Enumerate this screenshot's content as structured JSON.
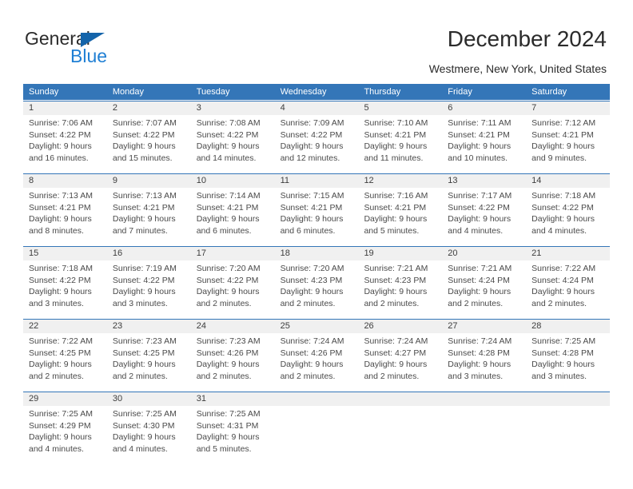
{
  "brand": {
    "word1": "General",
    "word2": "Blue",
    "triangle_color": "#1464aa",
    "blue_color": "#1f7fd4"
  },
  "header": {
    "title": "December 2024",
    "location": "Westmere, New York, United States"
  },
  "calendar": {
    "accent_color": "#3476b8",
    "day_header_bg": "#f0f0f0",
    "weekday_headers": [
      "Sunday",
      "Monday",
      "Tuesday",
      "Wednesday",
      "Thursday",
      "Friday",
      "Saturday"
    ],
    "weeks": [
      [
        {
          "day": "1",
          "sunrise": "Sunrise: 7:06 AM",
          "sunset": "Sunset: 4:22 PM",
          "daylight_line1": "Daylight: 9 hours",
          "daylight_line2": "and 16 minutes."
        },
        {
          "day": "2",
          "sunrise": "Sunrise: 7:07 AM",
          "sunset": "Sunset: 4:22 PM",
          "daylight_line1": "Daylight: 9 hours",
          "daylight_line2": "and 15 minutes."
        },
        {
          "day": "3",
          "sunrise": "Sunrise: 7:08 AM",
          "sunset": "Sunset: 4:22 PM",
          "daylight_line1": "Daylight: 9 hours",
          "daylight_line2": "and 14 minutes."
        },
        {
          "day": "4",
          "sunrise": "Sunrise: 7:09 AM",
          "sunset": "Sunset: 4:22 PM",
          "daylight_line1": "Daylight: 9 hours",
          "daylight_line2": "and 12 minutes."
        },
        {
          "day": "5",
          "sunrise": "Sunrise: 7:10 AM",
          "sunset": "Sunset: 4:21 PM",
          "daylight_line1": "Daylight: 9 hours",
          "daylight_line2": "and 11 minutes."
        },
        {
          "day": "6",
          "sunrise": "Sunrise: 7:11 AM",
          "sunset": "Sunset: 4:21 PM",
          "daylight_line1": "Daylight: 9 hours",
          "daylight_line2": "and 10 minutes."
        },
        {
          "day": "7",
          "sunrise": "Sunrise: 7:12 AM",
          "sunset": "Sunset: 4:21 PM",
          "daylight_line1": "Daylight: 9 hours",
          "daylight_line2": "and 9 minutes."
        }
      ],
      [
        {
          "day": "8",
          "sunrise": "Sunrise: 7:13 AM",
          "sunset": "Sunset: 4:21 PM",
          "daylight_line1": "Daylight: 9 hours",
          "daylight_line2": "and 8 minutes."
        },
        {
          "day": "9",
          "sunrise": "Sunrise: 7:13 AM",
          "sunset": "Sunset: 4:21 PM",
          "daylight_line1": "Daylight: 9 hours",
          "daylight_line2": "and 7 minutes."
        },
        {
          "day": "10",
          "sunrise": "Sunrise: 7:14 AM",
          "sunset": "Sunset: 4:21 PM",
          "daylight_line1": "Daylight: 9 hours",
          "daylight_line2": "and 6 minutes."
        },
        {
          "day": "11",
          "sunrise": "Sunrise: 7:15 AM",
          "sunset": "Sunset: 4:21 PM",
          "daylight_line1": "Daylight: 9 hours",
          "daylight_line2": "and 6 minutes."
        },
        {
          "day": "12",
          "sunrise": "Sunrise: 7:16 AM",
          "sunset": "Sunset: 4:21 PM",
          "daylight_line1": "Daylight: 9 hours",
          "daylight_line2": "and 5 minutes."
        },
        {
          "day": "13",
          "sunrise": "Sunrise: 7:17 AM",
          "sunset": "Sunset: 4:22 PM",
          "daylight_line1": "Daylight: 9 hours",
          "daylight_line2": "and 4 minutes."
        },
        {
          "day": "14",
          "sunrise": "Sunrise: 7:18 AM",
          "sunset": "Sunset: 4:22 PM",
          "daylight_line1": "Daylight: 9 hours",
          "daylight_line2": "and 4 minutes."
        }
      ],
      [
        {
          "day": "15",
          "sunrise": "Sunrise: 7:18 AM",
          "sunset": "Sunset: 4:22 PM",
          "daylight_line1": "Daylight: 9 hours",
          "daylight_line2": "and 3 minutes."
        },
        {
          "day": "16",
          "sunrise": "Sunrise: 7:19 AM",
          "sunset": "Sunset: 4:22 PM",
          "daylight_line1": "Daylight: 9 hours",
          "daylight_line2": "and 3 minutes."
        },
        {
          "day": "17",
          "sunrise": "Sunrise: 7:20 AM",
          "sunset": "Sunset: 4:22 PM",
          "daylight_line1": "Daylight: 9 hours",
          "daylight_line2": "and 2 minutes."
        },
        {
          "day": "18",
          "sunrise": "Sunrise: 7:20 AM",
          "sunset": "Sunset: 4:23 PM",
          "daylight_line1": "Daylight: 9 hours",
          "daylight_line2": "and 2 minutes."
        },
        {
          "day": "19",
          "sunrise": "Sunrise: 7:21 AM",
          "sunset": "Sunset: 4:23 PM",
          "daylight_line1": "Daylight: 9 hours",
          "daylight_line2": "and 2 minutes."
        },
        {
          "day": "20",
          "sunrise": "Sunrise: 7:21 AM",
          "sunset": "Sunset: 4:24 PM",
          "daylight_line1": "Daylight: 9 hours",
          "daylight_line2": "and 2 minutes."
        },
        {
          "day": "21",
          "sunrise": "Sunrise: 7:22 AM",
          "sunset": "Sunset: 4:24 PM",
          "daylight_line1": "Daylight: 9 hours",
          "daylight_line2": "and 2 minutes."
        }
      ],
      [
        {
          "day": "22",
          "sunrise": "Sunrise: 7:22 AM",
          "sunset": "Sunset: 4:25 PM",
          "daylight_line1": "Daylight: 9 hours",
          "daylight_line2": "and 2 minutes."
        },
        {
          "day": "23",
          "sunrise": "Sunrise: 7:23 AM",
          "sunset": "Sunset: 4:25 PM",
          "daylight_line1": "Daylight: 9 hours",
          "daylight_line2": "and 2 minutes."
        },
        {
          "day": "24",
          "sunrise": "Sunrise: 7:23 AM",
          "sunset": "Sunset: 4:26 PM",
          "daylight_line1": "Daylight: 9 hours",
          "daylight_line2": "and 2 minutes."
        },
        {
          "day": "25",
          "sunrise": "Sunrise: 7:24 AM",
          "sunset": "Sunset: 4:26 PM",
          "daylight_line1": "Daylight: 9 hours",
          "daylight_line2": "and 2 minutes."
        },
        {
          "day": "26",
          "sunrise": "Sunrise: 7:24 AM",
          "sunset": "Sunset: 4:27 PM",
          "daylight_line1": "Daylight: 9 hours",
          "daylight_line2": "and 2 minutes."
        },
        {
          "day": "27",
          "sunrise": "Sunrise: 7:24 AM",
          "sunset": "Sunset: 4:28 PM",
          "daylight_line1": "Daylight: 9 hours",
          "daylight_line2": "and 3 minutes."
        },
        {
          "day": "28",
          "sunrise": "Sunrise: 7:25 AM",
          "sunset": "Sunset: 4:28 PM",
          "daylight_line1": "Daylight: 9 hours",
          "daylight_line2": "and 3 minutes."
        }
      ],
      [
        {
          "day": "29",
          "sunrise": "Sunrise: 7:25 AM",
          "sunset": "Sunset: 4:29 PM",
          "daylight_line1": "Daylight: 9 hours",
          "daylight_line2": "and 4 minutes."
        },
        {
          "day": "30",
          "sunrise": "Sunrise: 7:25 AM",
          "sunset": "Sunset: 4:30 PM",
          "daylight_line1": "Daylight: 9 hours",
          "daylight_line2": "and 4 minutes."
        },
        {
          "day": "31",
          "sunrise": "Sunrise: 7:25 AM",
          "sunset": "Sunset: 4:31 PM",
          "daylight_line1": "Daylight: 9 hours",
          "daylight_line2": "and 5 minutes."
        },
        {
          "day": "",
          "sunrise": "",
          "sunset": "",
          "daylight_line1": "",
          "daylight_line2": ""
        },
        {
          "day": "",
          "sunrise": "",
          "sunset": "",
          "daylight_line1": "",
          "daylight_line2": ""
        },
        {
          "day": "",
          "sunrise": "",
          "sunset": "",
          "daylight_line1": "",
          "daylight_line2": ""
        },
        {
          "day": "",
          "sunrise": "",
          "sunset": "",
          "daylight_line1": "",
          "daylight_line2": ""
        }
      ]
    ]
  }
}
